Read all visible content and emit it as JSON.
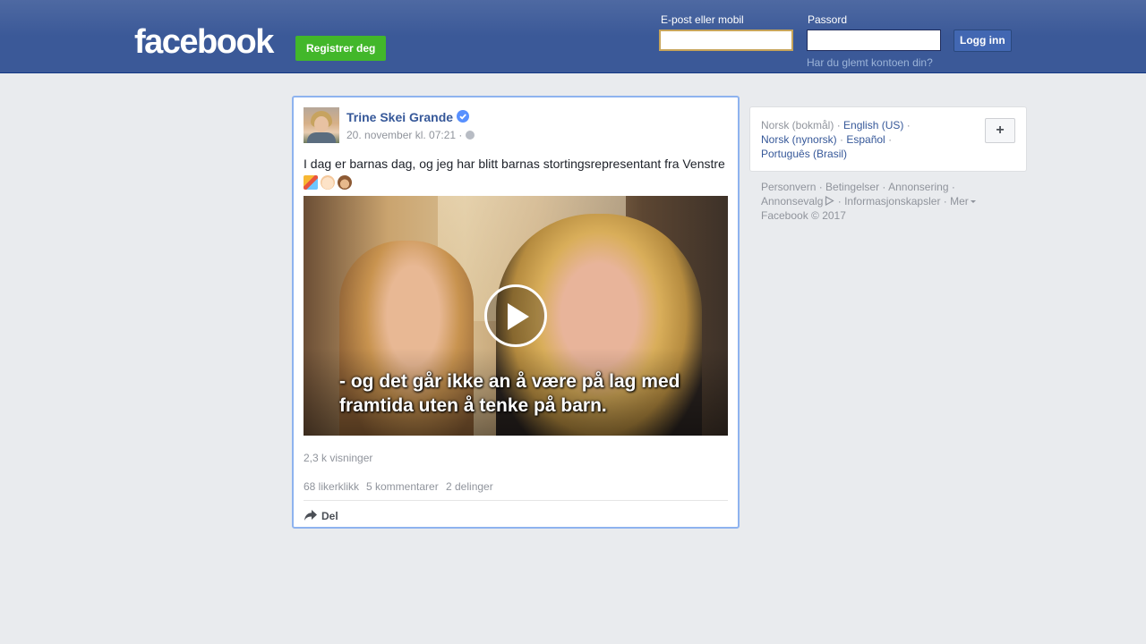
{
  "header": {
    "logo": "facebook",
    "register_label": "Registrer deg",
    "email_label": "E-post eller mobil",
    "email_value": "",
    "password_label": "Passord",
    "password_value": "",
    "login_label": "Logg inn",
    "forgot_label": "Har du glemt kontoen din?"
  },
  "post": {
    "author": "Trine Skei Grande",
    "verified": true,
    "date": "20. november kl. 07:21 ·",
    "text": "I dag er barnas dag, og jeg har blitt barnas stortingsrepresentant fra Venstre",
    "emojis": [
      "party-popper-icon",
      "baby-icon",
      "monkey-icon"
    ],
    "video": {
      "caption_line1": "- og det går ikke an å være på lag med",
      "caption_line2": "framtida uten å tenke på barn."
    },
    "views": "2,3 k visninger",
    "likes": "68 likerklikk",
    "comments": "5 kommentarer",
    "shares": "2 delinger",
    "share_label": "Del"
  },
  "languages": {
    "current": "Norsk (bokmål)",
    "options": [
      "English (US)",
      "Norsk (nynorsk)",
      "Español",
      "Português (Brasil)"
    ],
    "add_label": "+"
  },
  "footer": {
    "links": [
      "Personvern",
      "Betingelser",
      "Annonsering",
      "Annonsevalg",
      "Informasjonskapsler",
      "Mer"
    ],
    "copyright": "Facebook © 2017"
  },
  "colors": {
    "header_blue": "#3b5998",
    "link_blue": "#365899",
    "register_green": "#42b72a",
    "background": "#e9ebee"
  }
}
